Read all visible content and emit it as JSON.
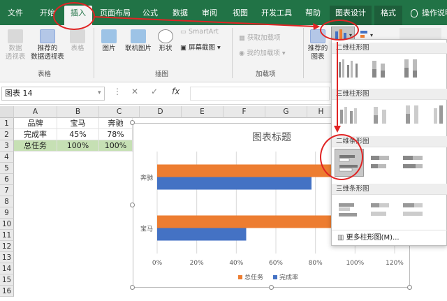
{
  "ribbon_tabs": [
    {
      "label": "文件",
      "left": 0
    },
    {
      "label": "开始"
    },
    {
      "label": "插入"
    },
    {
      "label": "页面布局"
    },
    {
      "label": "公式"
    },
    {
      "label": "数据"
    },
    {
      "label": "审阅"
    },
    {
      "label": "视图"
    },
    {
      "label": "开发工具"
    },
    {
      "label": "帮助"
    },
    {
      "label": "图表设计"
    },
    {
      "label": "格式"
    },
    {
      "label": "操作说明"
    }
  ],
  "ribbon": {
    "pivot": "数据\n透视表",
    "recommended_pivot": "推荐的\n数据透视表",
    "table": "表格",
    "group_tables": "表格",
    "picture": "图片",
    "online_picture": "联机图片",
    "shapes": "形状",
    "screenshot": "屏幕截图",
    "smartart": "SmartArt",
    "group_illustrations": "插图",
    "get_addins": "获取加载项",
    "my_addins": "我的加载项",
    "group_addins": "加载项",
    "recommended_charts": "推荐的\n图表"
  },
  "formula_bar": {
    "name_box": "图表 14",
    "fx": "fx"
  },
  "sheet": {
    "columns": [
      "A",
      "B",
      "C",
      "D",
      "E",
      "F",
      "G",
      "H"
    ],
    "rows": [
      "1",
      "2",
      "3",
      "4",
      "5",
      "6",
      "7",
      "8",
      "9",
      "10",
      "11",
      "12",
      "13",
      "14",
      "15",
      "16"
    ],
    "cells": {
      "A1": "品牌",
      "B1": "宝马",
      "C1": "奔驰",
      "A2": "完成率",
      "B2": "45%",
      "C2": "78%",
      "A3": "总任务",
      "B3": "100%",
      "C3": "100%"
    }
  },
  "chart_data": {
    "type": "bar",
    "orientation": "horizontal",
    "title": "图表标题",
    "categories": [
      "宝马",
      "奔驰"
    ],
    "series": [
      {
        "name": "总任务",
        "values": [
          1.0,
          1.0
        ],
        "color": "#ed7d31"
      },
      {
        "name": "完成率",
        "values": [
          0.45,
          0.78
        ],
        "color": "#4472c4"
      }
    ],
    "xlim": [
      0,
      1.2
    ],
    "xticks": [
      "0%",
      "20%",
      "40%",
      "60%",
      "80%",
      "100%",
      "120%"
    ],
    "legend": "bottom",
    "grid": true
  },
  "dropdown": {
    "sec1": "二维柱形图",
    "sec2": "三维柱形图",
    "sec3": "二维条形图",
    "sec4": "三维条形图",
    "more": "更多柱形图(M)..."
  },
  "colors": {
    "ribbon_green": "#217346",
    "highlight": "#e02424",
    "orange": "#ed7d31",
    "blue": "#4472c4"
  }
}
